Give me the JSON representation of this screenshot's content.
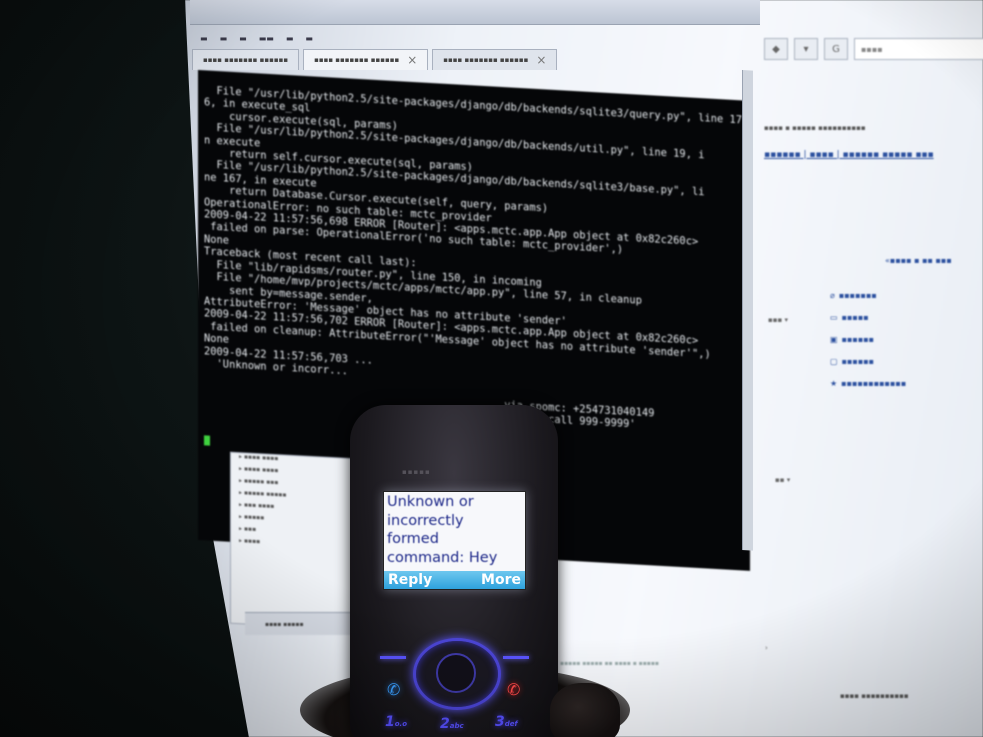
{
  "terminal": {
    "lines": [
      "  File \"/usr/lib/python2.5/site-packages/django/db/backends/sqlite3/query.py\", line 17",
      "6, in execute_sql",
      "    cursor.execute(sql, params)",
      "  File \"/usr/lib/python2.5/site-packages/django/db/backends/util.py\", line 19, i",
      "n execute",
      "    return self.cursor.execute(sql, params)",
      "  File \"/usr/lib/python2.5/site-packages/django/db/backends/sqlite3/base.py\", li",
      "ne 167, in execute",
      "    return Database.Cursor.execute(self, query, params)",
      "OperationalError: no such table: mctc_provider",
      "2009-04-22 11:57:56,698 ERROR [Router]: <apps.mctc.app.App object at 0x82c260c>",
      " failed on parse: OperationalError('no such table: mctc_provider',)",
      "None",
      "Traceback (most recent call last):",
      "  File \"lib/rapidsms/router.py\", line 150, in incoming",
      "  File \"/home/mvp/projects/mctc/apps/mctc/app.py\", line 57, in cleanup",
      "    sent by=message.sender,",
      "AttributeError: 'Message' object has no attribute 'sender'",
      "2009-04-22 11:57:56,702 ERROR [Router]: <apps.mctc.app.App object at 0x82c260c>",
      " failed on cleanup: AttributeError(\"'Message' object has no attribute 'sender'\",)",
      "None",
      "2009-04-22 11:57:56,703 ...",
      "  'Unknown or incorr...",
      "",
      "                                                via spomc: +254731040149",
      "                                                Please call 999-9999'"
    ]
  },
  "phone": {
    "message": [
      "Unknown or",
      "incorrectly",
      "formed",
      "command: Hey"
    ],
    "softkey_left": "Reply",
    "softkey_right": "More",
    "keys": [
      {
        "num": "1",
        "sub": "o.o"
      },
      {
        "num": "2",
        "sub": "abc"
      },
      {
        "num": "3",
        "sub": "def"
      }
    ]
  },
  "colors": {
    "terminal_bg": "#050608",
    "terminal_fg": "#e8ecf0",
    "phone_text": "#1f2a8a",
    "softkey_bar": "#2ea2dd",
    "keypad_glow": "#5750ff"
  },
  "icons": {
    "call": "call-icon",
    "end": "end-call-icon"
  }
}
